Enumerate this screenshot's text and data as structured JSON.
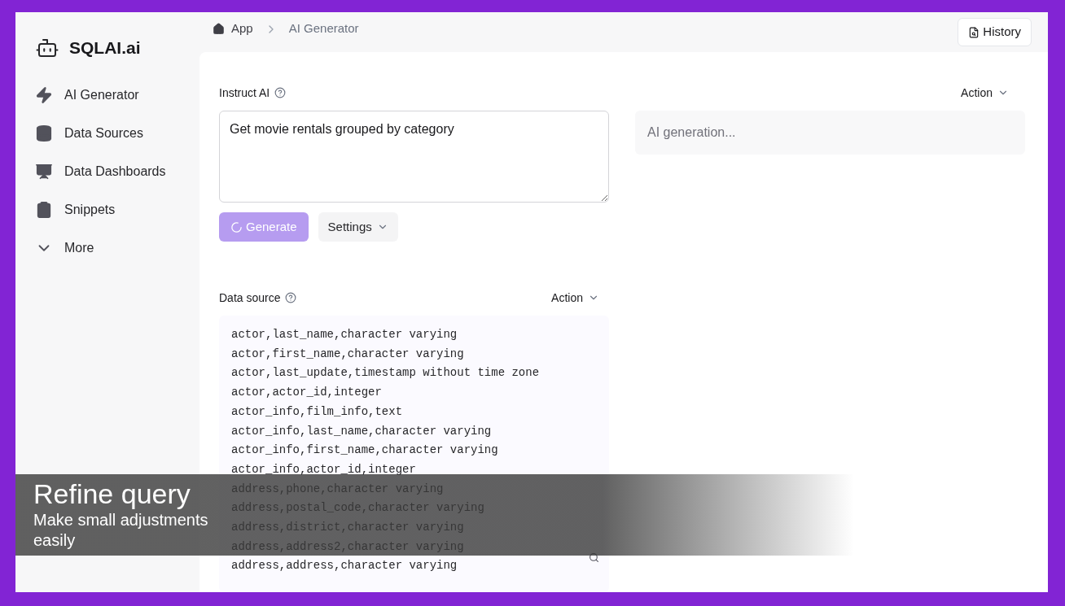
{
  "brand": {
    "name": "SQLAI.ai"
  },
  "sidebar": {
    "items": [
      {
        "label": "AI Generator",
        "selected": false
      },
      {
        "label": "Data Sources",
        "selected": false
      },
      {
        "label": "Data Dashboards",
        "selected": false
      },
      {
        "label": "Snippets",
        "selected": false
      },
      {
        "label": "More",
        "selected": false
      }
    ]
  },
  "breadcrumb": [
    "App",
    "AI Generator"
  ],
  "history_button": "History",
  "instruct": {
    "label": "Instruct AI",
    "value": "Get movie rentals grouped by category",
    "generate": "Generate",
    "generate_loading": true,
    "settings": "Settings"
  },
  "output": {
    "action": "Action",
    "placeholder": "AI generation..."
  },
  "data_source": {
    "label": "Data source",
    "action": "Action",
    "lines": [
      "actor,last_name,character varying",
      "actor,first_name,character varying",
      "actor,last_update,timestamp without time zone",
      "actor,actor_id,integer",
      "actor_info,film_info,text",
      "actor_info,last_name,character varying",
      "actor_info,first_name,character varying",
      "actor_info,actor_id,integer",
      "address,phone,character varying",
      "address,postal_code,character varying",
      "address,district,character varying",
      "address,address2,character varying",
      "address,address,character varying"
    ]
  },
  "caption": {
    "title": "Refine query",
    "subtitle": "Make small adjustments easily"
  }
}
